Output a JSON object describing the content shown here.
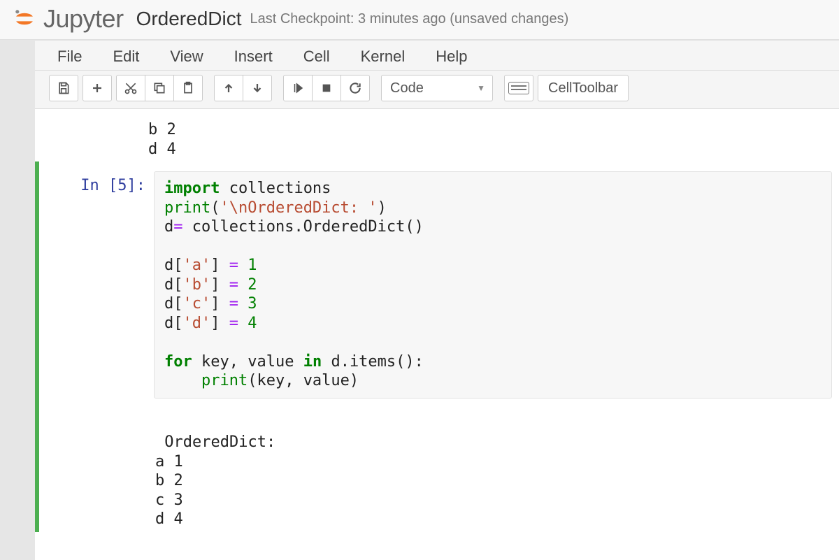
{
  "header": {
    "logo_text": "Jupyter",
    "notebook_name": "OrderedDict",
    "checkpoint": "Last Checkpoint: 3 minutes ago (unsaved changes)"
  },
  "menubar": [
    "File",
    "Edit",
    "View",
    "Insert",
    "Cell",
    "Kernel",
    "Help"
  ],
  "toolbar": {
    "cell_type": "Code",
    "cell_toolbar_label": "CellToolbar"
  },
  "prev_output_lines": [
    "b 2",
    "d 4"
  ],
  "cell": {
    "prompt": "In [5]:",
    "code_tokens": [
      [
        [
          "kw",
          "import"
        ],
        [
          "",
          " collections"
        ]
      ],
      [
        [
          "bi",
          "print"
        ],
        [
          "",
          "("
        ],
        [
          "str",
          "'\\nOrderedDict: '"
        ],
        [
          "",
          ")"
        ]
      ],
      [
        [
          "",
          "d"
        ],
        [
          "op",
          "="
        ],
        [
          "",
          " collections.OrderedDict()"
        ]
      ],
      [
        [
          "",
          ""
        ]
      ],
      [
        [
          "",
          "d["
        ],
        [
          "str",
          "'a'"
        ],
        [
          "",
          "] "
        ],
        [
          "op",
          "="
        ],
        [
          "",
          " "
        ],
        [
          "num",
          "1"
        ]
      ],
      [
        [
          "",
          "d["
        ],
        [
          "str",
          "'b'"
        ],
        [
          "",
          "] "
        ],
        [
          "op",
          "="
        ],
        [
          "",
          " "
        ],
        [
          "num",
          "2"
        ]
      ],
      [
        [
          "",
          "d["
        ],
        [
          "str",
          "'c'"
        ],
        [
          "",
          "] "
        ],
        [
          "op",
          "="
        ],
        [
          "",
          " "
        ],
        [
          "num",
          "3"
        ]
      ],
      [
        [
          "",
          "d["
        ],
        [
          "str",
          "'d'"
        ],
        [
          "",
          "] "
        ],
        [
          "op",
          "="
        ],
        [
          "",
          " "
        ],
        [
          "num",
          "4"
        ]
      ],
      [
        [
          "",
          ""
        ]
      ],
      [
        [
          "kw",
          "for"
        ],
        [
          "",
          " key, value "
        ],
        [
          "kw",
          "in"
        ],
        [
          "",
          " d.items():"
        ]
      ],
      [
        [
          "",
          "    "
        ],
        [
          "bi",
          "print"
        ],
        [
          "",
          "(key, value)"
        ]
      ]
    ],
    "output_lines": [
      "",
      " OrderedDict: ",
      "a 1",
      "b 2",
      "c 3",
      "d 4"
    ]
  }
}
